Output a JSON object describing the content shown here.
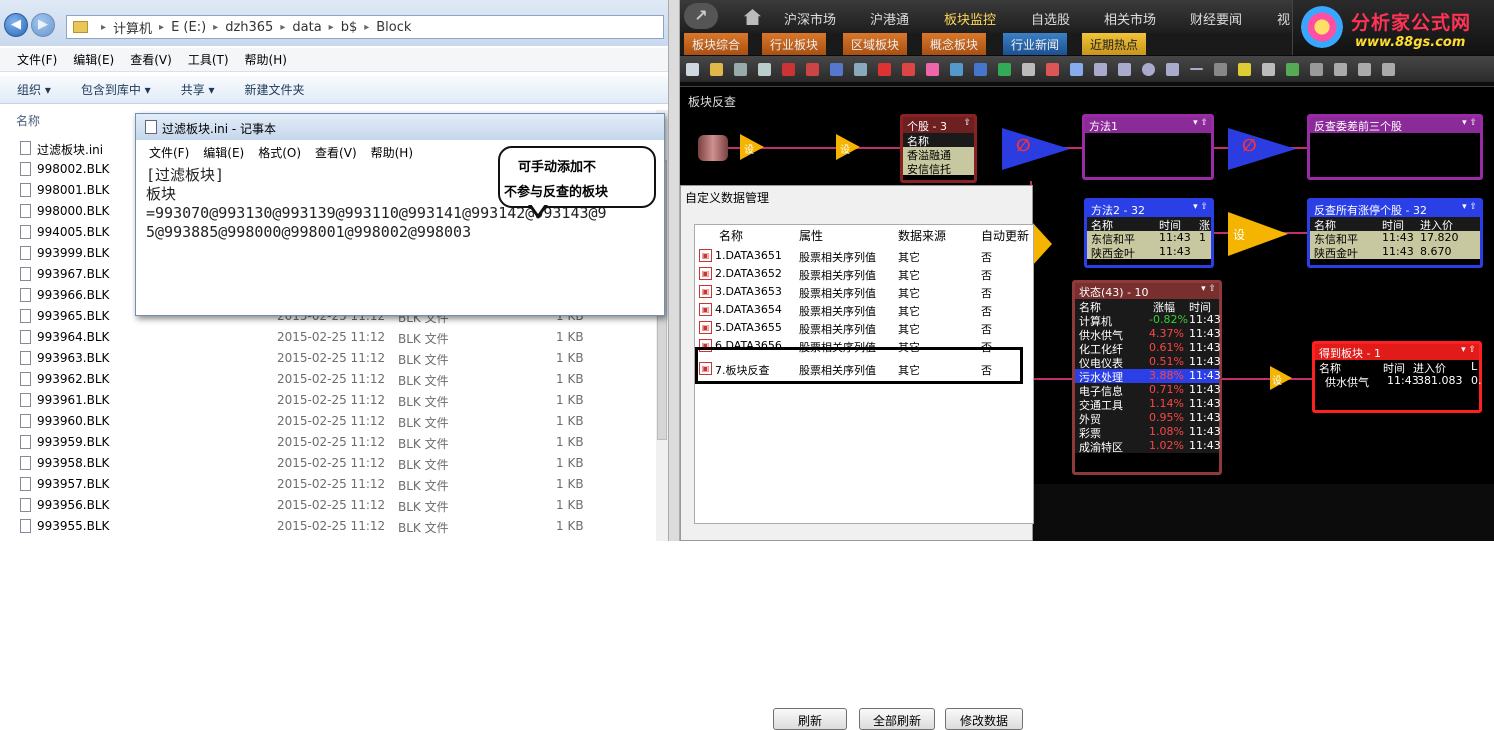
{
  "explorer": {
    "breadcrumb": [
      "计算机",
      "E (E:)",
      "dzh365",
      "data",
      "b$",
      "Block"
    ],
    "menu": [
      "文件(F)",
      "编辑(E)",
      "查看(V)",
      "工具(T)",
      "帮助(H)"
    ],
    "toolbar": [
      "组织 ▾",
      "包含到库中 ▾",
      "共享 ▾",
      "新建文件夹"
    ],
    "col_name": "名称",
    "files": [
      {
        "name": "过滤板块.ini",
        "date": "",
        "type": "",
        "size": ""
      },
      {
        "name": "998002.BLK",
        "date": "",
        "type": "",
        "size": ""
      },
      {
        "name": "998001.BLK",
        "date": "",
        "type": "",
        "size": ""
      },
      {
        "name": "998000.BLK",
        "date": "",
        "type": "",
        "size": ""
      },
      {
        "name": "994005.BLK",
        "date": "",
        "type": "",
        "size": ""
      },
      {
        "name": "993999.BLK",
        "date": "",
        "type": "",
        "size": ""
      },
      {
        "name": "993967.BLK",
        "date": "",
        "type": "",
        "size": ""
      },
      {
        "name": "993966.BLK",
        "date": "",
        "type": "",
        "size": ""
      },
      {
        "name": "993965.BLK",
        "date": "2015-02-25 11:12",
        "type": "BLK 文件",
        "size": "1 KB"
      },
      {
        "name": "993964.BLK",
        "date": "2015-02-25 11:12",
        "type": "BLK 文件",
        "size": "1 KB"
      },
      {
        "name": "993963.BLK",
        "date": "2015-02-25 11:12",
        "type": "BLK 文件",
        "size": "1 KB"
      },
      {
        "name": "993962.BLK",
        "date": "2015-02-25 11:12",
        "type": "BLK 文件",
        "size": "1 KB"
      },
      {
        "name": "993961.BLK",
        "date": "2015-02-25 11:12",
        "type": "BLK 文件",
        "size": "1 KB"
      },
      {
        "name": "993960.BLK",
        "date": "2015-02-25 11:12",
        "type": "BLK 文件",
        "size": "1 KB"
      },
      {
        "name": "993959.BLK",
        "date": "2015-02-25 11:12",
        "type": "BLK 文件",
        "size": "1 KB"
      },
      {
        "name": "993958.BLK",
        "date": "2015-02-25 11:12",
        "type": "BLK 文件",
        "size": "1 KB"
      },
      {
        "name": "993957.BLK",
        "date": "2015-02-25 11:12",
        "type": "BLK 文件",
        "size": "1 KB"
      },
      {
        "name": "993956.BLK",
        "date": "2015-02-25 11:12",
        "type": "BLK 文件",
        "size": "1 KB"
      },
      {
        "name": "993955.BLK",
        "date": "2015-02-25 11:12",
        "type": "BLK 文件",
        "size": "1 KB"
      }
    ]
  },
  "notepad": {
    "title": "过滤板块.ini - 记事本",
    "menu": [
      "文件(F)",
      "编辑(E)",
      "格式(O)",
      "查看(V)",
      "帮助(H)"
    ],
    "text": "[过滤板块]\n板块\n=993070@993130@993139@993110@993141@993142@993143@9\n5@993885@998000@998001@998002@998003"
  },
  "callout": {
    "line1": "可手动添加不",
    "line2": "不参与反查的板块"
  },
  "app": {
    "top_tabs": [
      "沪深市场",
      "沪港通",
      "板块监控",
      "自选股",
      "相关市场",
      "财经要闻",
      "视"
    ],
    "active_top": "板块监控",
    "sub_tabs": [
      "板块综合",
      "行业板块",
      "区域板块",
      "概念板块",
      "行业新闻",
      "近期热点"
    ],
    "brand_cn": "分析家公式网",
    "brand_url": "www.88gs.com",
    "canvas_label": "板块反查",
    "shape_label": "设",
    "nodes": {
      "stock": {
        "title": "个股 - 3",
        "hdr": "名称",
        "rows": [
          "香溢融通",
          "安信信托"
        ]
      },
      "method1": {
        "title": "方法1"
      },
      "query": {
        "title": "反查委差前三个股"
      },
      "method2": {
        "title": "方法2 - 32",
        "cols": [
          "名称",
          "时间",
          "涨"
        ],
        "rows": [
          [
            "东信和平",
            "11:43",
            "1"
          ],
          [
            "陕西金叶",
            "11:43",
            ""
          ]
        ]
      },
      "rise": {
        "title": "反查所有涨停个股 - 32",
        "cols": [
          "名称",
          "时间",
          "进入价"
        ],
        "rows": [
          [
            "东信和平",
            "11:43",
            "17.820"
          ],
          [
            "陕西金叶",
            "11:43",
            "8.670"
          ]
        ]
      },
      "status": {
        "title": "状态(43) - 10",
        "cols": [
          "名称",
          "涨幅",
          "时间"
        ],
        "rows": [
          [
            "计算机",
            "-0.82%",
            "11:43"
          ],
          [
            "供水供气",
            "4.37%",
            "11:43"
          ],
          [
            "化工化纤",
            "0.61%",
            "11:43"
          ],
          [
            "仪电仪表",
            "0.51%",
            "11:43"
          ],
          [
            "污水处理",
            "3.88%",
            "11:43"
          ],
          [
            "电子信息",
            "0.71%",
            "11:43"
          ],
          [
            "交通工具",
            "1.14%",
            "11:43"
          ],
          [
            "外贸",
            "0.95%",
            "11:43"
          ],
          [
            "彩票",
            "1.08%",
            "11:43"
          ],
          [
            "成渝特区",
            "1.02%",
            "11:43"
          ]
        ]
      },
      "result": {
        "title": "得到板块 - 1",
        "cols": [
          "名称",
          "时间",
          "进入价",
          "L"
        ],
        "rows": [
          [
            "供水供气",
            "11:43",
            "381.083",
            "0."
          ]
        ]
      }
    }
  },
  "dialog": {
    "title": "自定义数据管理",
    "cols": [
      "名称",
      "属性",
      "数据来源",
      "自动更新"
    ],
    "rows": [
      [
        "1.DATA3651",
        "股票相关序列值",
        "其它",
        "否"
      ],
      [
        "2.DATA3652",
        "股票相关序列值",
        "其它",
        "否"
      ],
      [
        "3.DATA3653",
        "股票相关序列值",
        "其它",
        "否"
      ],
      [
        "4.DATA3654",
        "股票相关序列值",
        "其它",
        "否"
      ],
      [
        "5.DATA3655",
        "股票相关序列值",
        "其它",
        "否"
      ],
      [
        "6.DATA3656",
        "股票相关序列值",
        "其它",
        "否"
      ],
      [
        "7.板块反查",
        "股票相关序列值",
        "其它",
        "否"
      ]
    ],
    "buttons": [
      "刷新",
      "全部刷新",
      "修改数据"
    ]
  }
}
